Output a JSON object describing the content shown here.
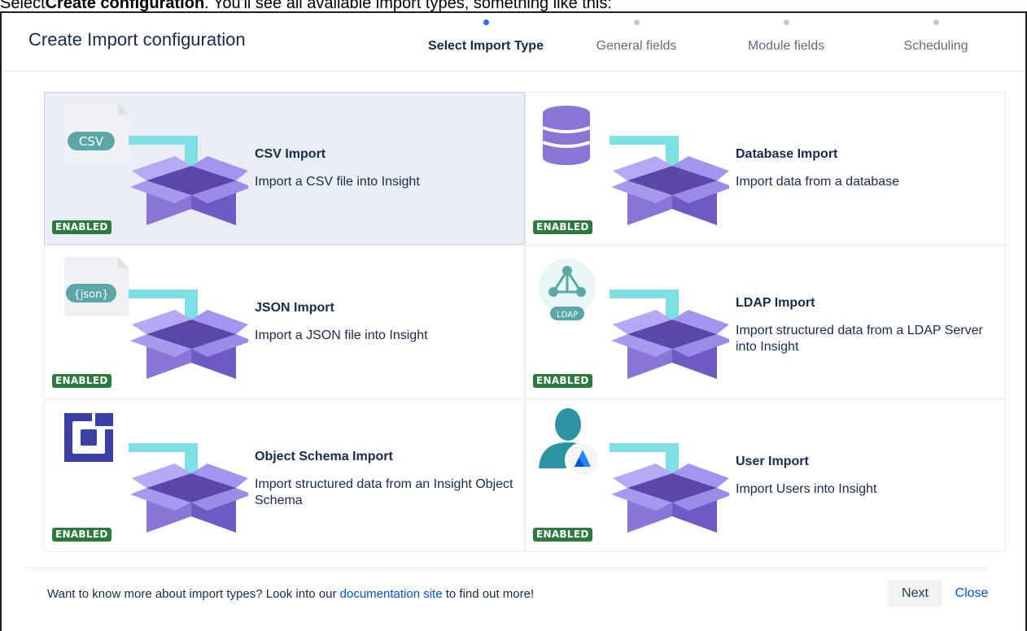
{
  "caption": {
    "prefix": "Select",
    "bold": "Create configuration",
    "suffix": ". You'll see all available import types, something like this:"
  },
  "dialog": {
    "title": "Create Import configuration",
    "steps": [
      {
        "label": "Select Import Type",
        "active": true
      },
      {
        "label": "General fields",
        "active": false
      },
      {
        "label": "Module fields",
        "active": false
      },
      {
        "label": "Scheduling",
        "active": false
      }
    ]
  },
  "import_types": [
    {
      "name": "CSV Import",
      "description": "Import a CSV file into Insight",
      "status": "ENABLED",
      "icon": "csv-file-icon",
      "selected": true,
      "file_tag": "CSV"
    },
    {
      "name": "Database Import",
      "description": "Import data from a database",
      "status": "ENABLED",
      "icon": "database-icon",
      "selected": false
    },
    {
      "name": "JSON Import",
      "description": "Import a JSON file into Insight",
      "status": "ENABLED",
      "icon": "json-file-icon",
      "selected": false,
      "file_tag": "{json}"
    },
    {
      "name": "LDAP Import",
      "description": "Import structured data from a LDAP Server into Insight",
      "status": "ENABLED",
      "icon": "ldap-icon",
      "selected": false,
      "icon_label": "LDAP"
    },
    {
      "name": "Object Schema Import",
      "description": "Import structured data from an Insight Object Schema",
      "status": "ENABLED",
      "icon": "object-schema-icon",
      "selected": false
    },
    {
      "name": "User Import",
      "description": "Import Users into Insight",
      "status": "ENABLED",
      "icon": "user-atlassian-icon",
      "selected": false
    }
  ],
  "footer": {
    "text_before": "Want to know more about import types? Look into our ",
    "link": "documentation site",
    "text_after": " to find out more!",
    "next_label": "Next",
    "close_label": "Close"
  },
  "colors": {
    "box": "#8a74d6",
    "arrow": "#7fe0e4",
    "badge": "#2c7a3e",
    "active_step": "#2f6fec",
    "link": "#0052cc",
    "selected_card": "#e9eef6"
  }
}
